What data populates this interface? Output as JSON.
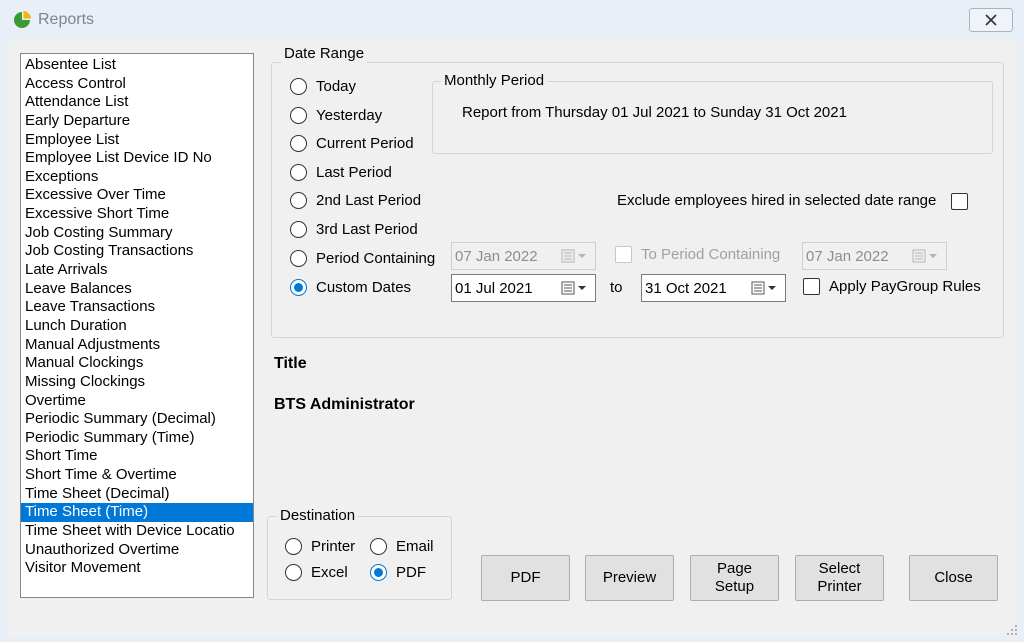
{
  "window": {
    "title": "Reports",
    "close_label": "Close window"
  },
  "report_list": {
    "items": [
      "Absentee List",
      "Access Control",
      "Attendance List",
      "Early Departure",
      "Employee List",
      "Employee List Device ID No",
      "Exceptions",
      "Excessive Over Time",
      "Excessive Short Time",
      "Job Costing Summary",
      "Job Costing Transactions",
      "Late Arrivals",
      "Leave Balances",
      "Leave Transactions",
      "Lunch Duration",
      "Manual Adjustments",
      "Manual Clockings",
      "Missing Clockings",
      "Overtime",
      "Periodic Summary (Decimal)",
      "Periodic Summary (Time)",
      "Short Time",
      "Short Time & Overtime",
      "Time Sheet (Decimal)",
      "Time Sheet (Time)",
      "Time Sheet with Device Locatio",
      "Unauthorized Overtime",
      "Visitor Movement"
    ],
    "selected": "Time Sheet (Time)"
  },
  "date_range": {
    "legend": "Date Range",
    "options": {
      "today": "Today",
      "yesterday": "Yesterday",
      "current_period": "Current Period",
      "last_period": "Last Period",
      "second_last_period": "2nd Last Period",
      "third_last_period": "3rd Last Period",
      "period_containing": "Period Containing",
      "custom_dates": "Custom Dates"
    },
    "selected_option": "custom_dates",
    "monthly_period": {
      "legend": "Monthly Period",
      "text": "Report from Thursday 01 Jul 2021 to Sunday 31 Oct 2021"
    },
    "exclude_hired_label": "Exclude employees hired in selected date range",
    "exclude_hired_checked": false,
    "period_containing_date": "07 Jan  2022",
    "to_period_containing_label": "To Period Containing",
    "to_period_containing_date": "07 Jan  2022",
    "custom_from": "01  Jul  2021",
    "to_label": "to",
    "custom_to": "31 Oct  2021",
    "apply_paygroup_label": "Apply PayGroup Rules",
    "apply_paygroup_checked": false
  },
  "title_label": "Title",
  "title_value": "BTS Administrator",
  "destination": {
    "legend": "Destination",
    "printer": "Printer",
    "email": "Email",
    "excel": "Excel",
    "pdf": "PDF",
    "selected": "pdf"
  },
  "buttons": {
    "pdf": "PDF",
    "preview": "Preview",
    "page_setup": "Page\nSetup",
    "select_printer": "Select\nPrinter",
    "close": "Close"
  },
  "colors": {
    "accent": "#0078d7",
    "window_bg": "#f0f0f0",
    "titlebar_bg": "#e9eff6"
  }
}
